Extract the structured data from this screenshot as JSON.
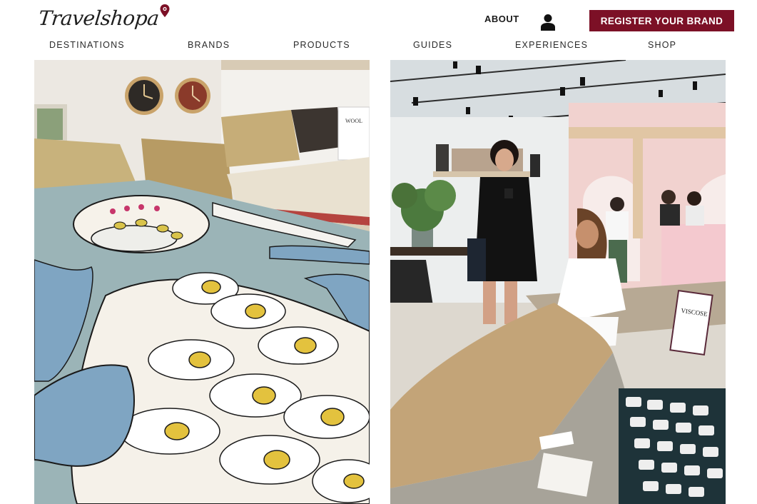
{
  "brand": {
    "logo_text": "Travelshopa",
    "logo_pin_color": "#7c1026"
  },
  "header": {
    "about_label": "ABOUT",
    "register_label": "REGISTER YOUR BRAND",
    "register_color": "#7c1026",
    "user_icon": "user-icon"
  },
  "nav": {
    "items": [
      {
        "label": "DESTINATIONS"
      },
      {
        "label": "BRANDS"
      },
      {
        "label": "PRODUCTS"
      },
      {
        "label": "GUIDES"
      },
      {
        "label": "EXPERIENCES"
      },
      {
        "label": "SHOP"
      }
    ]
  },
  "photos": {
    "left": {
      "sign_text": "WOOL"
    },
    "right": {
      "sign_text": "VISCOSE"
    }
  }
}
